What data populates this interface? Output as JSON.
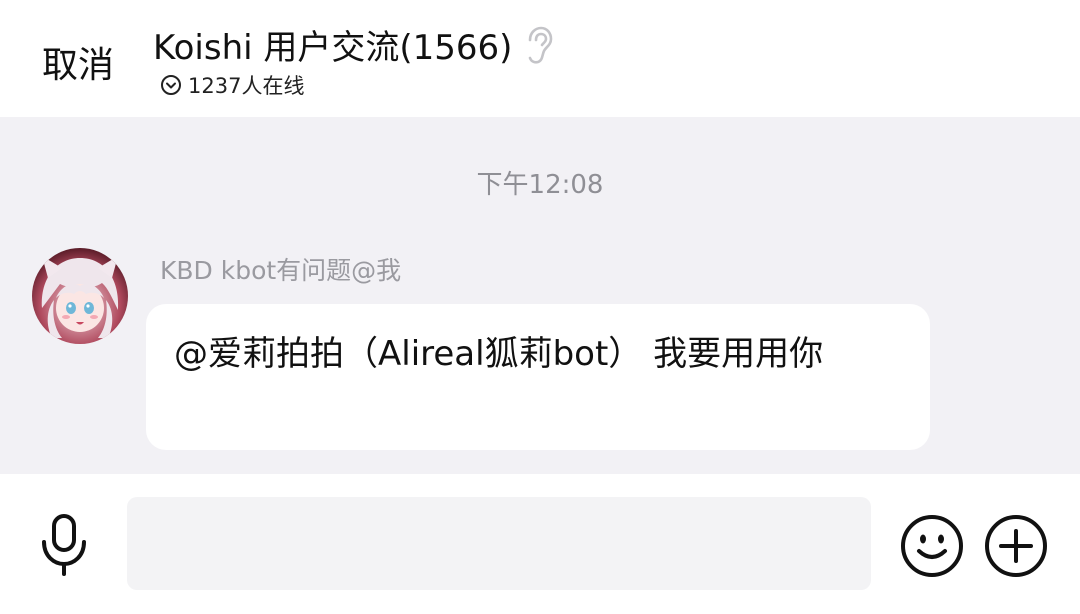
{
  "header": {
    "cancel_label": "取消",
    "title": "Koishi 用户交流(1566)",
    "online_text": "1237人在线",
    "ear_icon": "ear-icon",
    "chevron_icon": "chevron-down-circle-icon"
  },
  "chat": {
    "timestamp": "下午12:08",
    "messages": [
      {
        "sender": "KBD kbot有问题@我",
        "text": "@爱莉拍拍（Alireal狐莉bot） 我要用用你",
        "avatar": "user-avatar"
      }
    ]
  },
  "input_bar": {
    "placeholder": "",
    "mic_icon": "microphone-icon",
    "emoji_icon": "smiley-icon",
    "plus_icon": "plus-circle-icon"
  },
  "colors": {
    "chat_background": "#f2f1f5",
    "bubble_background": "#ffffff",
    "muted_text": "#9a9aa0"
  }
}
